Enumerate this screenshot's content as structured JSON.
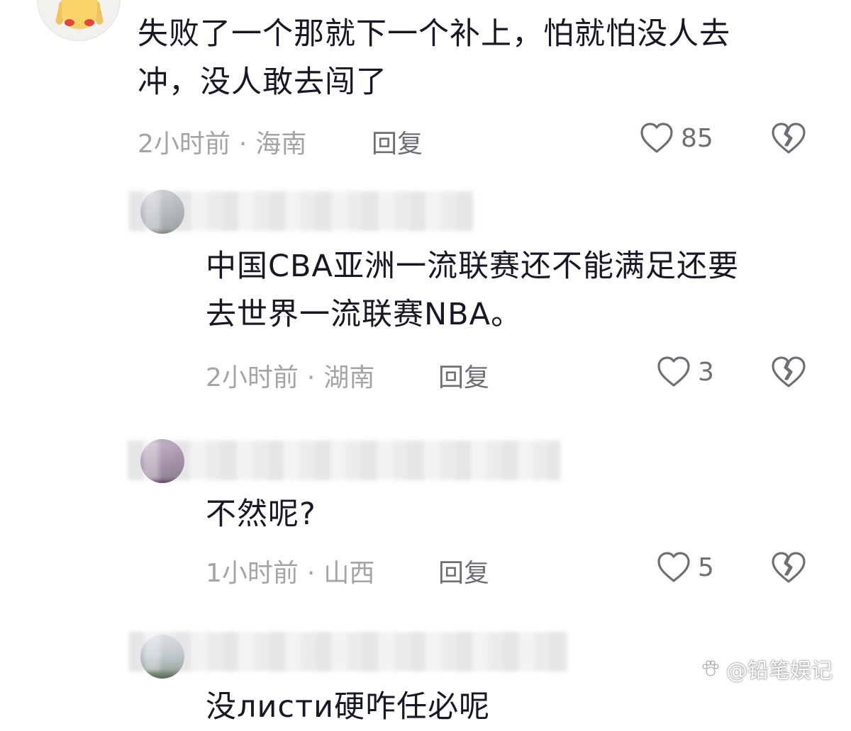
{
  "comments": [
    {
      "text_line1": "失败了一个那就下一个补上，怕就怕没人去",
      "text_line2": "冲，没人敢去闯了",
      "time": "2小时前",
      "sep": "·",
      "location": "海南",
      "reply_label": "回复",
      "likes": "85"
    },
    {
      "text_line1": "中国CBA亚洲一流联赛还不能满足还要",
      "text_line2": "去世界一流联赛NBA。",
      "time": "2小时前",
      "sep": "·",
      "location": "湖南",
      "reply_label": "回复",
      "likes": "3"
    },
    {
      "text_line1": "不然呢?",
      "time": "1小时前",
      "sep": "·",
      "location": "山西",
      "reply_label": "回复",
      "likes": "5"
    },
    {
      "text_line1": "没листи硬咋任必呢"
    }
  ],
  "watermark": {
    "text": "@铅笔娱记"
  },
  "icons": {
    "like": "heart-outline-icon",
    "dislike": "broken-heart-icon"
  },
  "colors": {
    "text": "#161823",
    "meta": "#a3a4a8",
    "action": "#6e6f75"
  }
}
